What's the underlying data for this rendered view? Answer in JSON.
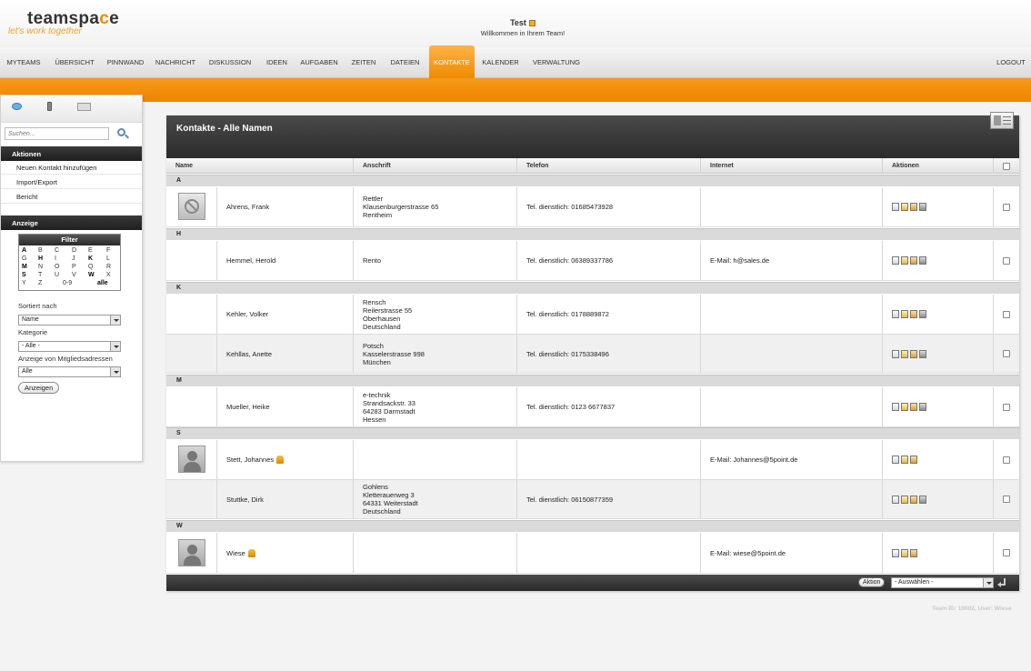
{
  "header": {
    "logo_text": "teamspace",
    "tagline": "let's work together",
    "user_name": "Test",
    "welcome": "Willkommen in Ihrem Team!"
  },
  "nav": {
    "items": [
      "MYTEAMS",
      "ÜBERSICHT",
      "PINNWAND",
      "NACHRICHT",
      "DISKUSSION",
      "IDEEN",
      "AUFGABEN",
      "ZEITEN",
      "DATEIEN",
      "KONTAKTE",
      "KALENDER",
      "VERWALTUNG"
    ],
    "active": "KONTAKTE",
    "logout": "LOGOUT"
  },
  "sidebar": {
    "search_placeholder": "Suchen...",
    "actions_title": "Aktionen",
    "actions": [
      "Neuen Kontakt hinzufügen",
      "Import/Export",
      "Bericht"
    ],
    "view_title": "Anzeige",
    "filter_title": "Filter",
    "filter_letters": [
      [
        "A",
        "B",
        "C",
        "D",
        "E",
        "F"
      ],
      [
        "G",
        "H",
        "I",
        "J",
        "K",
        "L"
      ],
      [
        "M",
        "N",
        "O",
        "P",
        "Q",
        "R"
      ],
      [
        "S",
        "T",
        "U",
        "V",
        "W",
        "X"
      ],
      [
        "Y",
        "Z",
        "0-9",
        "alle"
      ]
    ],
    "filter_active": [
      "A",
      "H",
      "K",
      "M",
      "S",
      "W",
      "alle"
    ],
    "sort_label": "Sortiert nach",
    "sort_value": "Name",
    "category_label": "Kategorie",
    "category_value": "- Alle -",
    "member_label": "Anzeige von Mitgliedsadressen",
    "member_value": "Alle",
    "show_button": "Anzeigen"
  },
  "main": {
    "title": "Kontakte - Alle Namen",
    "columns": [
      "Name",
      "Anschrift",
      "Telefon",
      "Internet",
      "Aktionen"
    ],
    "groups": [
      {
        "letter": "A",
        "contacts": [
          {
            "name": "Ahrens, Frank",
            "avatar": "none",
            "member": false,
            "address": [
              "Rettler",
              "Klausenburgerstrasse 65",
              "Rentheim"
            ],
            "phone": "Tel. dienstlich: 01685473928",
            "internet": "",
            "actions": [
              "view",
              "edit",
              "mail",
              "delete"
            ]
          }
        ]
      },
      {
        "letter": "H",
        "contacts": [
          {
            "name": "Hemmel, Herold",
            "avatar": "",
            "member": false,
            "address": [
              "Rento"
            ],
            "phone": "Tel. dienstlich: 06389337786",
            "internet": "E-Mail: h@sales.de",
            "actions": [
              "view",
              "edit",
              "mail",
              "delete"
            ]
          }
        ]
      },
      {
        "letter": "K",
        "contacts": [
          {
            "name": "Kehler, Volker",
            "avatar": "",
            "member": false,
            "address": [
              "Rensch",
              "Reilerstrasse 55",
              "Oberhausen",
              "Deutschland"
            ],
            "phone": "Tel. dienstlich: 0178889872",
            "internet": "",
            "actions": [
              "view",
              "edit",
              "mail",
              "delete"
            ]
          },
          {
            "name": "Kehllas, Anette",
            "avatar": "",
            "member": false,
            "address": [
              "Potsch",
              "Kasselerstrasse 998",
              "München"
            ],
            "phone": "Tel. dienstlich: 0175338496",
            "internet": "",
            "actions": [
              "view",
              "edit",
              "mail",
              "delete"
            ]
          }
        ]
      },
      {
        "letter": "M",
        "contacts": [
          {
            "name": "Mueller, Heike",
            "avatar": "",
            "member": false,
            "address": [
              "e-technik",
              "Strandsackstr. 33",
              "64283 Darmstadt",
              "Hessen"
            ],
            "phone": "Tel. dienstlich: 0123 6677837",
            "internet": "",
            "actions": [
              "view",
              "edit",
              "mail",
              "delete"
            ]
          }
        ]
      },
      {
        "letter": "S",
        "contacts": [
          {
            "name": "Stett, Johannes",
            "avatar": "person",
            "member": true,
            "address": [],
            "phone": "",
            "internet": "E-Mail: Johannes@5point.de",
            "actions": [
              "view",
              "edit",
              "mail"
            ]
          },
          {
            "name": "Stuttke, Dirk",
            "avatar": "",
            "member": false,
            "address": [
              "Gohlens",
              "Kletterauerweg 3",
              "64331 Weiterstadt",
              "Deutschland"
            ],
            "phone": "Tel. dienstlich: 06150877359",
            "internet": "",
            "actions": [
              "view",
              "edit",
              "mail",
              "delete"
            ]
          }
        ]
      },
      {
        "letter": "W",
        "contacts": [
          {
            "name": "Wiese",
            "avatar": "person",
            "member": true,
            "address": [],
            "phone": "",
            "internet": "E-Mail: wiese@5point.de",
            "actions": [
              "view",
              "edit",
              "mail"
            ]
          }
        ]
      }
    ],
    "footer_action_button": "Aktion",
    "footer_select": "- Auswählen -"
  },
  "footer_info": "Team ID: 10002, User: Wiese",
  "colors": {
    "accent": "#f08a00",
    "dark_header": "#2c2c2c"
  }
}
